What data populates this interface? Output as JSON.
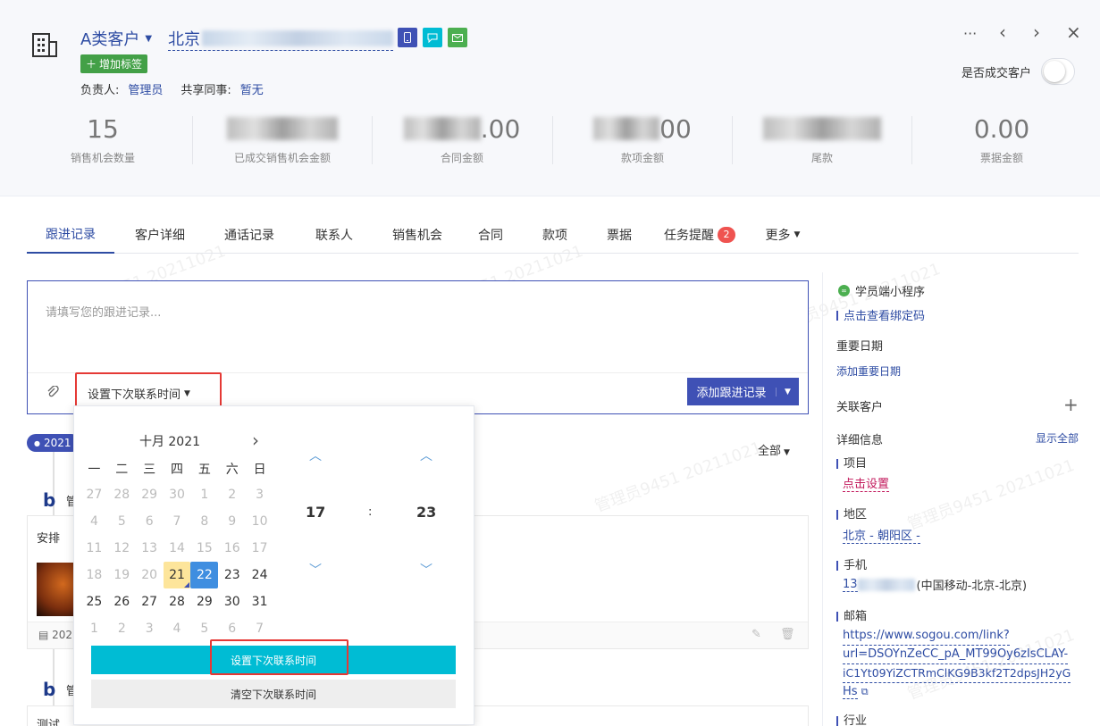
{
  "header": {
    "customer_type": "A类客户",
    "customer_name_prefix": "北京",
    "add_tag": "增加标签",
    "owner_label": "负责人:",
    "owner_value": "管理员",
    "shared_label": "共享同事:",
    "shared_value": "暂无",
    "deal_label": "是否成交客户",
    "more_icon": "···",
    "prev_icon": "‹",
    "next_icon": "›",
    "close_icon": "×",
    "icon_buttons": [
      {
        "name": "phone-icon",
        "color": "#3f51b5"
      },
      {
        "name": "message-icon",
        "color": "#00bcd4"
      },
      {
        "name": "email-icon",
        "color": "#4caf50"
      }
    ]
  },
  "stats": [
    {
      "value": "15",
      "label": "销售机会数量"
    },
    {
      "value": "",
      "label": "已成交销售机会金额"
    },
    {
      "value": ".00",
      "label": "合同金额"
    },
    {
      "value": "00",
      "label": "款项金额"
    },
    {
      "value": "",
      "label": "尾款"
    },
    {
      "value": "0.00",
      "label": "票据金额"
    }
  ],
  "tabs": [
    {
      "label": "跟进记录",
      "active": true
    },
    {
      "label": "客户详细"
    },
    {
      "label": "通话记录"
    },
    {
      "label": "联系人"
    },
    {
      "label": "销售机会"
    },
    {
      "label": "合同"
    },
    {
      "label": "款项"
    },
    {
      "label": "票据"
    },
    {
      "label": "任务提醒",
      "badge": "2"
    },
    {
      "label": "更多"
    }
  ],
  "editor": {
    "placeholder": "请填写您的跟进记录...",
    "next_contact": "设置下次联系时间",
    "add_button": "添加跟进记录"
  },
  "timeline": {
    "date_chip": "2021",
    "filter": "全部",
    "card1_title": "安排",
    "card1_date": "202",
    "card2_title": "测试",
    "initial": "管"
  },
  "picker": {
    "month_title": "十月 2021",
    "weekdays": [
      "一",
      "二",
      "三",
      "四",
      "五",
      "六",
      "日"
    ],
    "weeks": [
      [
        {
          "d": "27",
          "m": 1
        },
        {
          "d": "28",
          "m": 1
        },
        {
          "d": "29",
          "m": 1
        },
        {
          "d": "30",
          "m": 1
        },
        {
          "d": "1",
          "m": 1
        },
        {
          "d": "2",
          "m": 1
        },
        {
          "d": "3",
          "m": 1
        }
      ],
      [
        {
          "d": "4",
          "m": 1
        },
        {
          "d": "5",
          "m": 1
        },
        {
          "d": "6",
          "m": 1
        },
        {
          "d": "7",
          "m": 1
        },
        {
          "d": "8",
          "m": 1
        },
        {
          "d": "9",
          "m": 1
        },
        {
          "d": "10",
          "m": 1
        }
      ],
      [
        {
          "d": "11",
          "m": 1
        },
        {
          "d": "12",
          "m": 1
        },
        {
          "d": "13",
          "m": 1
        },
        {
          "d": "14",
          "m": 1
        },
        {
          "d": "15",
          "m": 1
        },
        {
          "d": "16",
          "m": 1
        },
        {
          "d": "17",
          "m": 1
        }
      ],
      [
        {
          "d": "18",
          "m": 1
        },
        {
          "d": "19",
          "m": 1
        },
        {
          "d": "20",
          "m": 1
        },
        {
          "d": "21",
          "t": 1
        },
        {
          "d": "22",
          "s": 1
        },
        {
          "d": "23"
        },
        {
          "d": "24"
        }
      ],
      [
        {
          "d": "25"
        },
        {
          "d": "26"
        },
        {
          "d": "27"
        },
        {
          "d": "28"
        },
        {
          "d": "29"
        },
        {
          "d": "30"
        },
        {
          "d": "31"
        }
      ],
      [
        {
          "d": "1",
          "m": 1
        },
        {
          "d": "2",
          "m": 1
        },
        {
          "d": "3",
          "m": 1
        },
        {
          "d": "4",
          "m": 1
        },
        {
          "d": "5",
          "m": 1
        },
        {
          "d": "6",
          "m": 1
        },
        {
          "d": "7",
          "m": 1
        }
      ]
    ],
    "hour": "17",
    "separator": ":",
    "minute": "23",
    "set_button": "设置下次联系时间",
    "clear_button": "清空下次联系时间"
  },
  "sidebar": {
    "mini_program": "学员端小程序",
    "bind_code": "点击查看绑定码",
    "important_date": "重要日期",
    "add_important_date": "添加重要日期",
    "related_customer": "关联客户",
    "add_icon": "+",
    "detail_info": "详细信息",
    "show_all": "显示全部",
    "project_label": "项目",
    "project_value": "点击设置",
    "region_label": "地区",
    "region_value": "北京 - 朝阳区 -",
    "phone_label": "手机",
    "phone_prefix": "13",
    "phone_carrier": "(中国移动-北京-北京)",
    "email_label": "邮箱",
    "email_lines": [
      "https://www.sogou.com/link?",
      "url=DSOYnZeCC_pA_MT99Oy6zIsCLAY-",
      "iC1Yt09YiZCTRmClKG9B3kf2T2dpsJH2yG",
      "Hs"
    ],
    "industry_label": "行业"
  },
  "watermark": "管理员9451 20211021",
  "colors": {
    "primary": "#3f51b5",
    "cyan": "#00bcd4",
    "green": "#4caf50",
    "highlight_red": "#e53935"
  }
}
